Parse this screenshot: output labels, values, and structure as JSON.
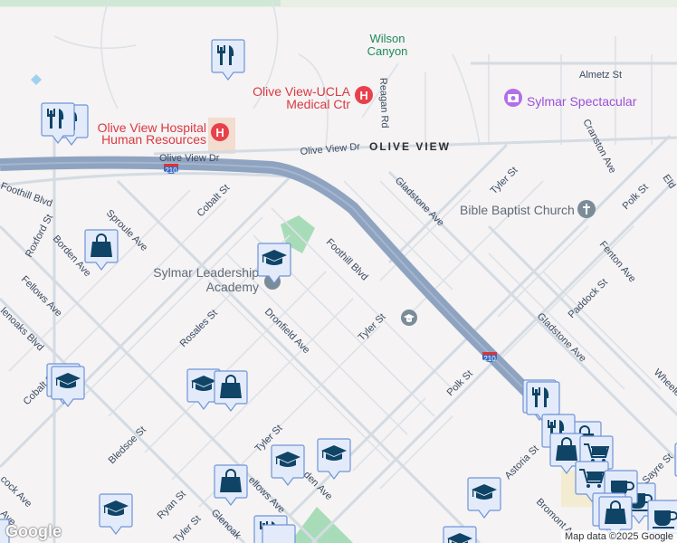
{
  "map": {
    "places": {
      "wilson_canyon": [
        "Wilson",
        "Canyon"
      ],
      "olive_view_ucla": [
        "Olive View-UCLA",
        "Medical Ctr"
      ],
      "olive_view_hospital_hr": [
        "Olive View Hospital",
        "Human Resources"
      ],
      "sylmar_spectacular": "Sylmar Spectacular",
      "bible_baptist": "Bible Baptist Church",
      "sylmar_leadership": [
        "Sylmar Leadership",
        "Academy"
      ],
      "olive_view_area": "OLIVE VIEW"
    },
    "streets": {
      "almetz": "Almetz St",
      "reagan": "Reagan Rd",
      "olive_view_dr_1": "Olive View Dr",
      "olive_view_dr_2": "Olive View Dr",
      "cranston": "Cranston Ave",
      "tyler_1": "Tyler St",
      "tyler_2": "Tyler St",
      "tyler_3": "Tyler St",
      "tyler_4": "Tyler St",
      "gladstone_1": "Gladstone Ave",
      "gladstone_2": "Gladstone Ave",
      "polk_1": "Polk St",
      "polk_2": "Polk St",
      "eldridge": "Eld",
      "fenton": "Fenton Ave",
      "paddock": "Paddock St",
      "wheeler": "Wheele",
      "foothill_1": "Foothill Blvd",
      "foothill_2": "Foothill Blvd",
      "cobalt_1": "Cobalt St",
      "cobalt_2": "Cobalt St",
      "sproule": "Sproule Ave",
      "roxford": "Roxford St",
      "borden_1": "Borden Ave",
      "borden_2": "den Ave",
      "fellows_1": "Fellows Ave",
      "fellows_2": "ellows Ave",
      "glenoaks_1": "lenoaks Blvd",
      "glenoaks_2": "Glenoak",
      "rosales": "Rosales St",
      "dronfield": "Dronfield Ave",
      "bledsoe": "Bledsoe St",
      "ryan": "Ryan St",
      "astoria": "Astoria St",
      "bromont": "Bromont A",
      "sayre": "Sayre St",
      "hancock": "cock Ave",
      "ave_partial": "Ave"
    },
    "highway_shield": "210",
    "colors": {
      "background": "#f5f3f3",
      "freeway": "#8ea3c0",
      "marker_fill": "#e3ebfb",
      "marker_icon": "#0f4466",
      "park": "#a8dcb8",
      "hospital": "#e8414b"
    }
  },
  "attribution": "Map data ©2025 Google",
  "logo": "Google"
}
